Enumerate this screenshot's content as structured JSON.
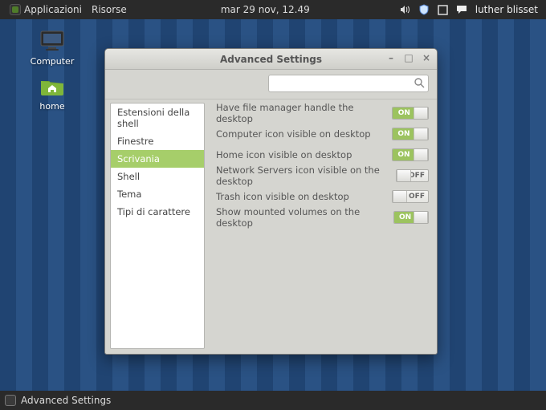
{
  "panel": {
    "menu_applications": "Applicazioni",
    "menu_resources": "Risorse",
    "clock": "mar 29 nov, 12.49",
    "username": "luther blisset"
  },
  "desktop": {
    "computer_label": "Computer",
    "home_label": "home"
  },
  "window": {
    "title": "Advanced Settings",
    "search_placeholder": "",
    "sidebar": {
      "items": [
        "Estensioni della shell",
        "Finestre",
        "Scrivania",
        "Shell",
        "Tema",
        "Tipi di carattere"
      ],
      "selected_index": 2
    },
    "settings": [
      {
        "label": "Have file manager handle the desktop",
        "state": "ON"
      },
      {
        "label": "Computer icon visible on desktop",
        "state": "ON"
      },
      {
        "label": "Home icon visible on desktop",
        "state": "ON"
      },
      {
        "label": "Network Servers icon visible on the desktop",
        "state": "OFF"
      },
      {
        "label": "Trash icon visible on desktop",
        "state": "OFF"
      },
      {
        "label": "Show mounted volumes on the desktop",
        "state": "ON"
      }
    ],
    "toggle_text": {
      "on": "ON",
      "off": "OFF"
    }
  },
  "taskbar": {
    "app_label": "Advanced Settings"
  },
  "colors": {
    "accent": "#9cc35f"
  }
}
